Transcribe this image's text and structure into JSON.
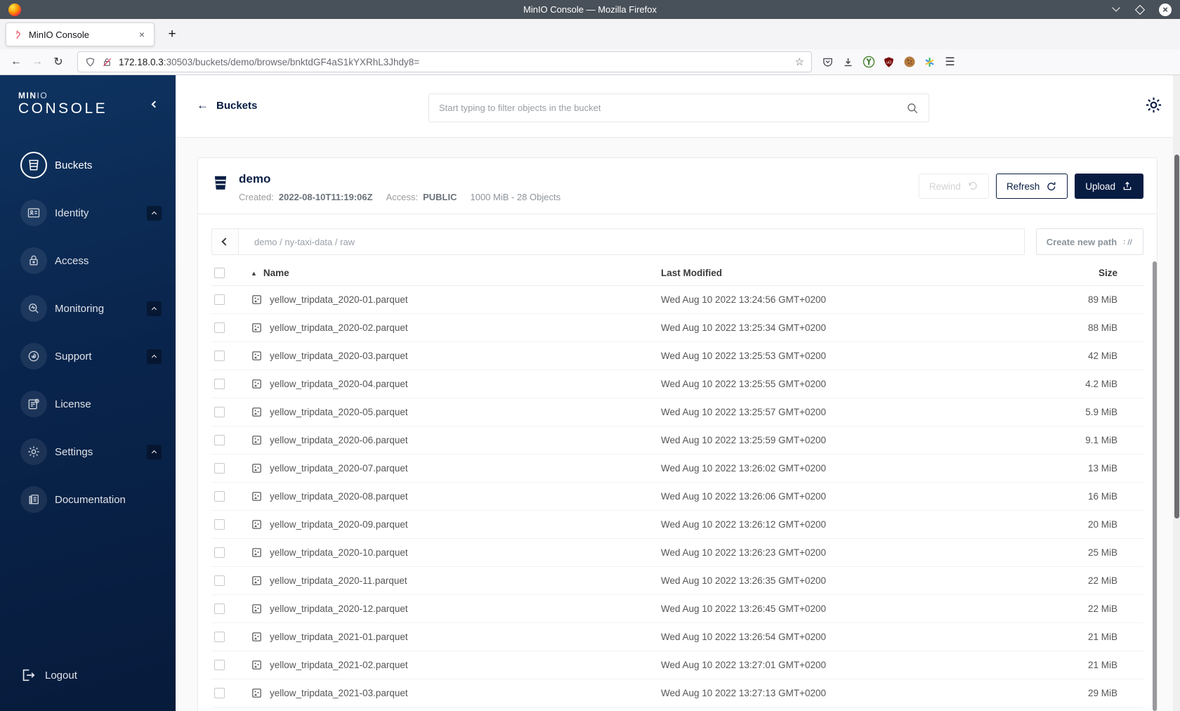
{
  "titlebar": {
    "title": "MinIO Console — Mozilla Firefox",
    "close_glyph": "×"
  },
  "tabbar": {
    "active_tab": "MinIO Console",
    "tab_close": "×",
    "new_tab": "+"
  },
  "navbar": {
    "back": "←",
    "forward": "→",
    "reload": "↻",
    "url_host": "172.18.0.3",
    "url_rest": ":30503/buckets/demo/browse/bnktdGF4aS1kYXRhL3Jhdy8=",
    "bookmark": "☆",
    "menu": "☰"
  },
  "sidebar": {
    "logo_min": "MIN",
    "logo_io": "IO",
    "logo_console": "CONSOLE",
    "items": [
      {
        "label": "Buckets"
      },
      {
        "label": "Identity"
      },
      {
        "label": "Access"
      },
      {
        "label": "Monitoring"
      },
      {
        "label": "Support"
      },
      {
        "label": "License"
      },
      {
        "label": "Settings"
      },
      {
        "label": "Documentation"
      }
    ],
    "logout": "Logout"
  },
  "header": {
    "back_label": "Buckets",
    "back_arrow": "←",
    "search_placeholder": "Start typing to filter objects in the bucket"
  },
  "bucket": {
    "name": "demo",
    "created_label": "Created:",
    "created_value": "2022-08-10T11:19:06Z",
    "access_label": "Access:",
    "access_value": "PUBLIC",
    "usage": "1000 MiB - 28 Objects"
  },
  "actions": {
    "rewind": "Rewind",
    "refresh": "Refresh",
    "upload": "Upload",
    "create_path": "Create new path"
  },
  "breadcrumb": {
    "path": "demo / ny-taxi-data / raw"
  },
  "table": {
    "headers": {
      "name": "Name",
      "modified": "Last Modified",
      "size": "Size"
    },
    "sort_asc": "▲",
    "rows": [
      {
        "name": "yellow_tripdata_2020-01.parquet",
        "modified": "Wed Aug 10 2022 13:24:56 GMT+0200",
        "size": "89 MiB"
      },
      {
        "name": "yellow_tripdata_2020-02.parquet",
        "modified": "Wed Aug 10 2022 13:25:34 GMT+0200",
        "size": "88 MiB"
      },
      {
        "name": "yellow_tripdata_2020-03.parquet",
        "modified": "Wed Aug 10 2022 13:25:53 GMT+0200",
        "size": "42 MiB"
      },
      {
        "name": "yellow_tripdata_2020-04.parquet",
        "modified": "Wed Aug 10 2022 13:25:55 GMT+0200",
        "size": "4.2 MiB"
      },
      {
        "name": "yellow_tripdata_2020-05.parquet",
        "modified": "Wed Aug 10 2022 13:25:57 GMT+0200",
        "size": "5.9 MiB"
      },
      {
        "name": "yellow_tripdata_2020-06.parquet",
        "modified": "Wed Aug 10 2022 13:25:59 GMT+0200",
        "size": "9.1 MiB"
      },
      {
        "name": "yellow_tripdata_2020-07.parquet",
        "modified": "Wed Aug 10 2022 13:26:02 GMT+0200",
        "size": "13 MiB"
      },
      {
        "name": "yellow_tripdata_2020-08.parquet",
        "modified": "Wed Aug 10 2022 13:26:06 GMT+0200",
        "size": "16 MiB"
      },
      {
        "name": "yellow_tripdata_2020-09.parquet",
        "modified": "Wed Aug 10 2022 13:26:12 GMT+0200",
        "size": "20 MiB"
      },
      {
        "name": "yellow_tripdata_2020-10.parquet",
        "modified": "Wed Aug 10 2022 13:26:23 GMT+0200",
        "size": "25 MiB"
      },
      {
        "name": "yellow_tripdata_2020-11.parquet",
        "modified": "Wed Aug 10 2022 13:26:35 GMT+0200",
        "size": "22 MiB"
      },
      {
        "name": "yellow_tripdata_2020-12.parquet",
        "modified": "Wed Aug 10 2022 13:26:45 GMT+0200",
        "size": "22 MiB"
      },
      {
        "name": "yellow_tripdata_2021-01.parquet",
        "modified": "Wed Aug 10 2022 13:26:54 GMT+0200",
        "size": "21 MiB"
      },
      {
        "name": "yellow_tripdata_2021-02.parquet",
        "modified": "Wed Aug 10 2022 13:27:01 GMT+0200",
        "size": "21 MiB"
      },
      {
        "name": "yellow_tripdata_2021-03.parquet",
        "modified": "Wed Aug 10 2022 13:27:13 GMT+0200",
        "size": "29 MiB"
      }
    ]
  },
  "colors": {
    "accent": "#081C42",
    "sidebar_top": "#0e3360",
    "sidebar_bottom": "#071b3b",
    "titlebar": "#485059"
  }
}
